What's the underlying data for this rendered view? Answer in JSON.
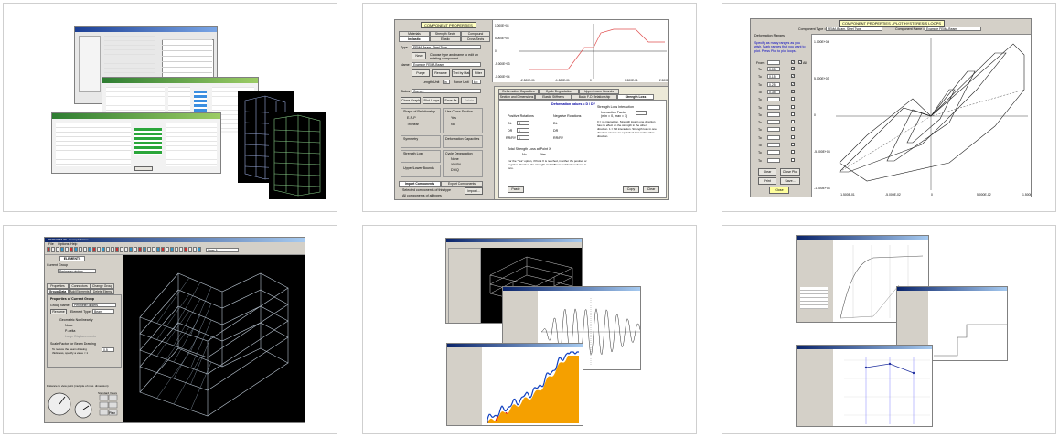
{
  "tiles": {
    "t2": {
      "title": "COMPONENT PROPERTIES",
      "tabs_row1": [
        "Materials",
        "Strength Sects",
        "Compound"
      ],
      "tabs_row2": [
        "Inelastic",
        "Elastic",
        "Cross Sects"
      ],
      "type_label": "Type",
      "type_value": "FEMA Beam, Steel Type",
      "new_button": "New",
      "new_hint": "Choose type and name to edit an existing component.",
      "name_label": "Name",
      "name_value": "Example FEMA Beam",
      "purge": "Purge",
      "rename": "Rename",
      "filter": "Filter",
      "text_by_mat": "Text by Mat.",
      "length_unit_label": "Length Unit",
      "length_unit": "in",
      "force_unit_label": "Force Unit",
      "force_unit": "kip",
      "status_label": "Status",
      "status_value": "Current",
      "close_graph": "Close Graph",
      "plot_loops": "Plot Loops",
      "save_as": "Save As",
      "delete": "Delete",
      "shape_title": "Shape of Relationship",
      "shape_opts": [
        "E-P-P",
        "Trilinear"
      ],
      "cross_title": "Use Cross Section",
      "yes": "Yes",
      "no": "No",
      "symmetry_title": "Symmetry",
      "deform_cap_title": "Deformation Capacities",
      "strength_loss_title": "Strength Loss",
      "cyclic_title": "Cycle Degradation",
      "cyclic_opts": [
        "None",
        "YN/SN",
        "DY/Q"
      ],
      "upper_title": "Upper/Lower Bounds",
      "import_tab": "Import Components",
      "export_tab": "Export Components",
      "import_opt1": "Selected components of this type",
      "import_opt2": "All components of all types",
      "import_btn": "Import...",
      "lower_tabs1": [
        "Deformation Capacities",
        "Cyclic Degradation",
        "Upper/Lower Bounds"
      ],
      "lower_tabs2": [
        "Section and Dimensions",
        "Elastic Stiffness",
        "Basic F-D Relationship",
        "Strength Loss"
      ],
      "deform_title": "Deformation values = D / DY",
      "pos_rot": "Positive Rotations",
      "neg_rot": "Negative Rotations",
      "dl": "DL",
      "dr": "DR",
      "rurdy": "RR/RY",
      "dl_val": "3",
      "dr_val": "1",
      "rr_val": "1",
      "sl_title": "Strength Loss Interaction",
      "sl_factor": "Interaction Factor (min = 0, max = 1)",
      "sl_desc": "0 = no interaction. Strength loss in one direction has no effect on the strength in the other direction. 1 = full interaction. Strength loss in one direction causes an equivalent loss in the other direction.",
      "total_q": "Total Strength Loss at Point X",
      "pin_note": "For the \"Yes\" option, if Point X is reached, in either the positive or negative direction, the strength and stiffness suddenly reduces to zero.",
      "paste": "Paste",
      "copy": "Copy",
      "clear": "Clear",
      "y_ticks": [
        "1.000E+04",
        "5.000E+03",
        "0",
        "-5.000E+03",
        "-1.000E+04"
      ],
      "x_ticks": [
        "-2.500E-01",
        "-1.500E-01",
        "0",
        "1.500E-01",
        "2.500E-01"
      ]
    },
    "t3": {
      "title": "COMPONENT PROPERTIES - PLOT HYSTERESIS LOOPS",
      "ctype_label": "Component Type =",
      "ctype": "FEMA Beam, Steel Type",
      "cname_label": "Component Name =",
      "cname": "Example FEMA Beam",
      "ranges_title": "Deformation Ranges",
      "ranges_desc": "Specify as many ranges as you wish. Mark ranges that you want to plot. Press Plot to plot loops.",
      "from_label": "From",
      "all_label": "All",
      "range_labels": [
        "To",
        "To",
        "To",
        "To",
        "To",
        "To",
        "To",
        "To",
        "To",
        "To",
        "To",
        "To",
        "To"
      ],
      "range_values": [
        "0.05",
        "0.15",
        "0.25",
        "0.35",
        "",
        "",
        "",
        "",
        "",
        "",
        "",
        "",
        ""
      ],
      "clear": "Clear",
      "close_plot": "Close Plot",
      "print": "Print",
      "save": "Save...",
      "close": "Close",
      "y_ticks": [
        "1.000E+04",
        "5.000E+03",
        "0",
        "-5.000E+03",
        "-1.000E+04"
      ],
      "x_ticks": [
        "-1.500E-01",
        "-5.000E-02",
        "0",
        "5.000E-02",
        "1.500E-01"
      ]
    },
    "t4": {
      "title": "PERFORM-3D - Example Frame",
      "menu": [
        "File",
        "Options",
        "Help"
      ],
      "elements_tab": "ELEMENTS",
      "current_label": "Current Group",
      "group_value": "Perimeter girders",
      "tabs": [
        "Properties",
        "Connectors",
        "Change Group"
      ],
      "tabs2": [
        "Group Data",
        "Add Elements",
        "Delete Elems"
      ],
      "props_title": "Properties of Current Group",
      "group_name_label": "Group Name",
      "group_name": "Perimeter girders",
      "rename": "Rename",
      "element_type_label": "Element Type",
      "element_type": "Beam",
      "geom_title": "Geometric Nonlinearity",
      "geom_opts": [
        "None",
        "P-delta",
        "Large Displacements"
      ],
      "scale_title": "Scale Factor for Beam Drawing",
      "scale_desc": "To reduce the beam drawing thickness, specify a value < 1",
      "scale_value": "0.5",
      "bottom_label": "Distance to view point (multiple of max. dimension)",
      "view_label": "Standard Views",
      "plan": "Plan",
      "load_label": "Case 1"
    }
  }
}
